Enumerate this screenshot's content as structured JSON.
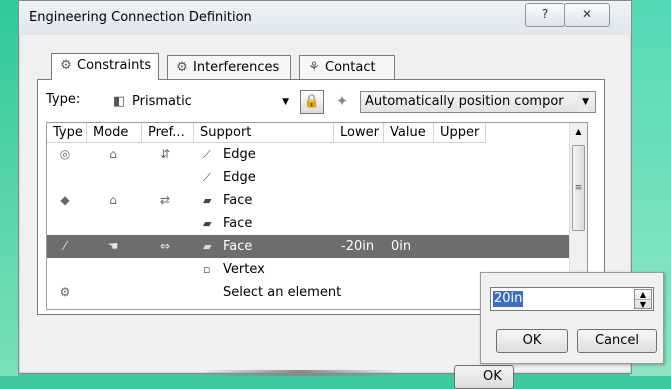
{
  "window": {
    "title": "Engineering Connection Definition",
    "help_button": "?",
    "close_button": "✕"
  },
  "tabs": [
    {
      "label": "Constraints",
      "icon": "constraints-icon",
      "glyph": "⚙",
      "active": true
    },
    {
      "label": "Interferences",
      "icon": "interferences-icon",
      "glyph": "⚙",
      "active": false
    },
    {
      "label": "Contact",
      "icon": "contact-icon",
      "glyph": "⚘",
      "active": false
    }
  ],
  "type_row": {
    "label": "Type:",
    "type_value": "Prismatic",
    "type_icon_glyph": "◧",
    "lock_glyph": "🔒",
    "wand_glyph": "✦",
    "auto_position_value": "Automatically position compor"
  },
  "grid": {
    "columns": [
      "Type",
      "Mode",
      "Pref...",
      "Support",
      "Lower",
      "Value",
      "Upper"
    ],
    "rows": [
      {
        "type_glyph": "◎",
        "mode_glyph": "⌂",
        "pref_glyph": "⇵",
        "support_glyph": "⟋",
        "support": "Edge",
        "lower": "",
        "value": "",
        "upper": "",
        "selected": false
      },
      {
        "type_glyph": "",
        "mode_glyph": "",
        "pref_glyph": "",
        "support_glyph": "⟋",
        "support": "Edge",
        "lower": "",
        "value": "",
        "upper": "",
        "selected": false
      },
      {
        "type_glyph": "◆",
        "mode_glyph": "⌂",
        "pref_glyph": "⇄",
        "support_glyph": "▰",
        "support": "Face",
        "lower": "",
        "value": "",
        "upper": "",
        "selected": false
      },
      {
        "type_glyph": "",
        "mode_glyph": "",
        "pref_glyph": "",
        "support_glyph": "▰",
        "support": "Face",
        "lower": "",
        "value": "",
        "upper": "",
        "selected": false
      },
      {
        "type_glyph": "⁄",
        "mode_glyph": "☚",
        "pref_glyph": "⇔",
        "support_glyph": "▰",
        "support": "Face",
        "lower": "-20in",
        "value": "0in",
        "upper": "",
        "selected": true
      },
      {
        "type_glyph": "",
        "mode_glyph": "",
        "pref_glyph": "",
        "support_glyph": "▫",
        "support": "Vertex",
        "lower": "",
        "value": "",
        "upper": "",
        "selected": false
      },
      {
        "type_glyph": "⚙",
        "mode_glyph": "",
        "pref_glyph": "",
        "support_glyph": "",
        "support": "Select an element",
        "lower": "",
        "value": "",
        "upper": "",
        "selected": false
      }
    ],
    "scroll_up": "▲",
    "scroll_thumb_grip": "≡"
  },
  "footer": {
    "ok_label": "OK"
  },
  "value_popup": {
    "value": "20in",
    "spin_up": "▲",
    "spin_down": "▼",
    "ok_label": "OK",
    "cancel_label": "Cancel"
  }
}
